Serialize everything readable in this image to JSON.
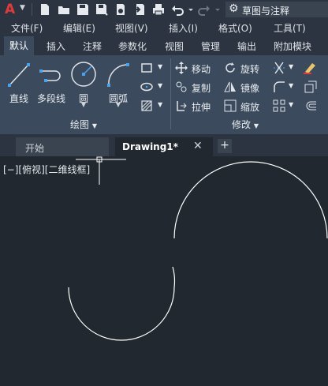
{
  "app": {
    "workspace": "草图与注释",
    "workspace_icon": "gear-icon"
  },
  "menu": {
    "items": [
      "文件(F)",
      "编辑(E)",
      "视图(V)",
      "插入(I)",
      "格式(O)",
      "工具(T)"
    ]
  },
  "ribbon_tabs": [
    "默认",
    "插入",
    "注释",
    "参数化",
    "视图",
    "管理",
    "输出",
    "附加模块"
  ],
  "draw_panel": {
    "title": "绘图",
    "buttons": {
      "line": "直线",
      "polyline": "多段线",
      "circle": "圆",
      "arc": "圆弧"
    }
  },
  "modify_panel": {
    "title": "修改",
    "buttons": {
      "move": "移动",
      "rotate": "旋转",
      "copy": "复制",
      "mirror": "镜像",
      "stretch": "拉伸",
      "scale": "缩放"
    }
  },
  "doc_tabs": {
    "start": "开始",
    "current": "Drawing1*",
    "close": "✕",
    "new": "+"
  },
  "canvas": {
    "view_label": "[−][俯视][二维线框]"
  },
  "colors": {
    "accent": "#3b4a5c",
    "canvas": "#212830",
    "logo": "#e23a3a"
  }
}
